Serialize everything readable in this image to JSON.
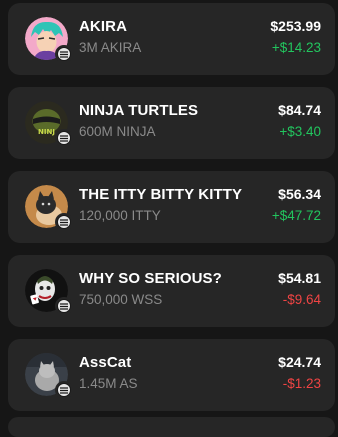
{
  "colors": {
    "positive": "#22c55e",
    "negative": "#ef4444"
  },
  "tokens": [
    {
      "name": "AKIRA",
      "holding": "3M AKIRA",
      "value": "$253.99",
      "change": "+$14.23",
      "direction": "up"
    },
    {
      "name": "NINJA TURTLES",
      "holding": "600M NINJA",
      "value": "$84.74",
      "change": "+$3.40",
      "direction": "up"
    },
    {
      "name": "THE ITTY BITTY KITTY",
      "holding": "120,000 ITTY",
      "value": "$56.34",
      "change": "+$47.72",
      "direction": "up"
    },
    {
      "name": "WHY SO SERIOUS?",
      "holding": "750,000 WSS",
      "value": "$54.81",
      "change": "-$9.64",
      "direction": "down"
    },
    {
      "name": "AssCat",
      "holding": "1.45M AS",
      "value": "$24.74",
      "change": "-$1.23",
      "direction": "down"
    }
  ]
}
